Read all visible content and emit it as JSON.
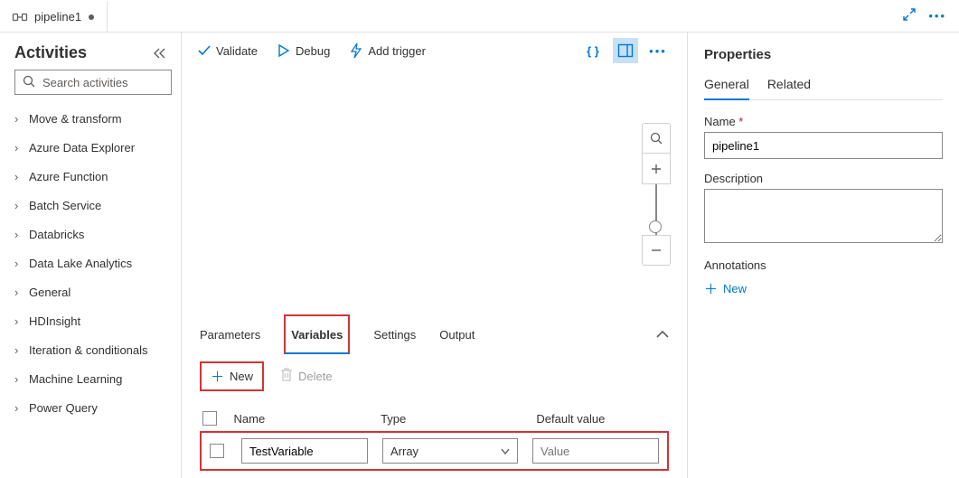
{
  "tab": {
    "title": "pipeline1"
  },
  "sidebar": {
    "title": "Activities",
    "search_placeholder": "Search activities",
    "items": [
      {
        "label": "Move & transform"
      },
      {
        "label": "Azure Data Explorer"
      },
      {
        "label": "Azure Function"
      },
      {
        "label": "Batch Service"
      },
      {
        "label": "Databricks"
      },
      {
        "label": "Data Lake Analytics"
      },
      {
        "label": "General"
      },
      {
        "label": "HDInsight"
      },
      {
        "label": "Iteration & conditionals"
      },
      {
        "label": "Machine Learning"
      },
      {
        "label": "Power Query"
      }
    ]
  },
  "toolbar": {
    "validate_label": "Validate",
    "debug_label": "Debug",
    "addtrigger_label": "Add trigger"
  },
  "bottom_tabs": {
    "parameters": "Parameters",
    "variables": "Variables",
    "settings": "Settings",
    "output": "Output"
  },
  "var_panel": {
    "new_label": "New",
    "delete_label": "Delete",
    "col_name": "Name",
    "col_type": "Type",
    "col_default": "Default value",
    "rows": [
      {
        "name": "TestVariable",
        "type": "Array",
        "value_placeholder": "Value"
      }
    ]
  },
  "properties": {
    "title": "Properties",
    "tab_general": "General",
    "tab_related": "Related",
    "name_label": "Name",
    "name_value": "pipeline1",
    "desc_label": "Description",
    "annotations_label": "Annotations",
    "ann_new_label": "New"
  }
}
